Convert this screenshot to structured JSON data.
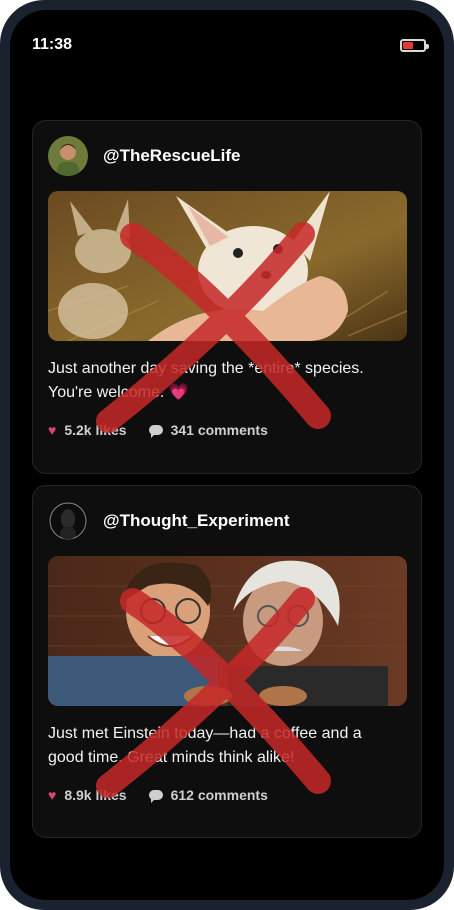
{
  "status_bar": {
    "time": "11:38",
    "battery_icon": "battery-low-icon",
    "battery_level": 0.5,
    "battery_color": "#e53935"
  },
  "posts": [
    {
      "handle": "@TheRescueLife",
      "caption": "Just another day saving the *entire* species. You're welcome. 💗",
      "likes": "5.2k likes",
      "comments": "341 comments",
      "overlay_icon": "red-x-icon",
      "image_icon": "fennec-fox-photo"
    },
    {
      "handle": "@Thought_Experiment",
      "caption": "Just met Einstein today—had a coffee and a good time. Great minds think alike!",
      "likes": "8.9k likes",
      "comments": "612 comments",
      "overlay_icon": "red-x-icon",
      "image_icon": "selfie-with-einstein-photo"
    }
  ],
  "colors": {
    "accent_heart": "#e0446d",
    "x_red": "#d32f2f"
  }
}
